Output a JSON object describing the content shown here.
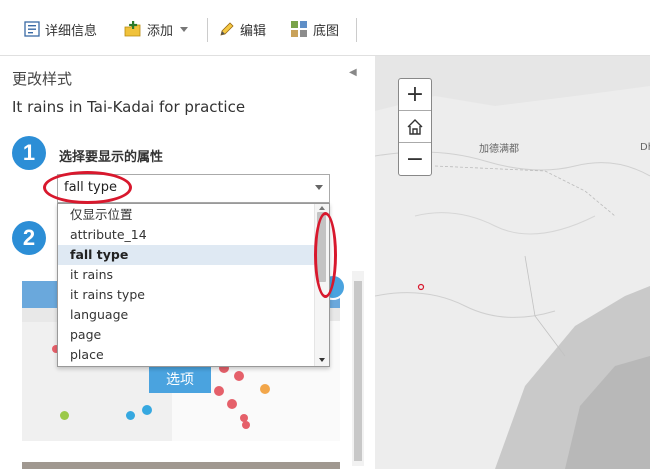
{
  "toolbar": {
    "details_label": "详细信息",
    "add_label": "添加",
    "edit_label": "编辑",
    "basemap_label": "底图"
  },
  "panel": {
    "title": "更改样式",
    "layer_name": "It rains in Tai-Kadai for practice",
    "step1_number": "1",
    "step1_label": "选择要显示的属性",
    "step2_number": "2"
  },
  "attribute_select": {
    "value": "fall type",
    "options": [
      "仅显示位置",
      "attribute_14",
      "fall type",
      "it rains",
      "it rains type",
      "language",
      "page",
      "place"
    ],
    "selected_index": 2
  },
  "style": {
    "options_label": "选项"
  },
  "map": {
    "zoom_in": "+",
    "zoom_out": "−",
    "place_labels": [
      "加德满都",
      "Dhaka"
    ]
  },
  "colors": {
    "accent": "#2c8ed6",
    "annotation": "#d8182d",
    "selected_option_bg": "#dfe9f3"
  }
}
